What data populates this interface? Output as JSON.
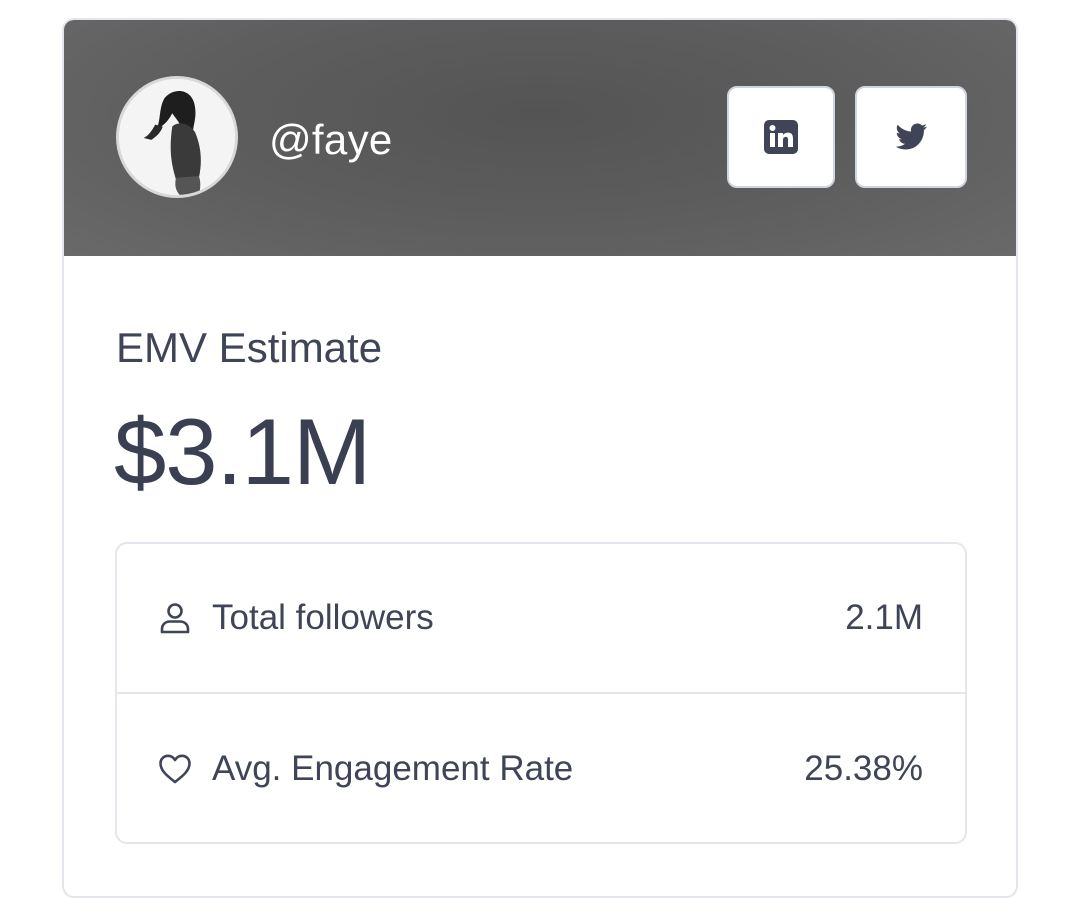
{
  "profile": {
    "handle": "@faye",
    "avatar_icon": "profile-photo"
  },
  "social": {
    "linkedin_icon": "linkedin-icon",
    "twitter_icon": "twitter-icon"
  },
  "emv": {
    "label": "EMV Estimate",
    "value": "$3.1M"
  },
  "stats": [
    {
      "icon": "user-icon",
      "label": "Total followers",
      "value": "2.1M"
    },
    {
      "icon": "heart-icon",
      "label": "Avg. Engagement Rate",
      "value": "25.38%"
    }
  ],
  "colors": {
    "header_bg": "#5e5e5e",
    "text": "#3f4556",
    "border": "#e3e6ec"
  }
}
